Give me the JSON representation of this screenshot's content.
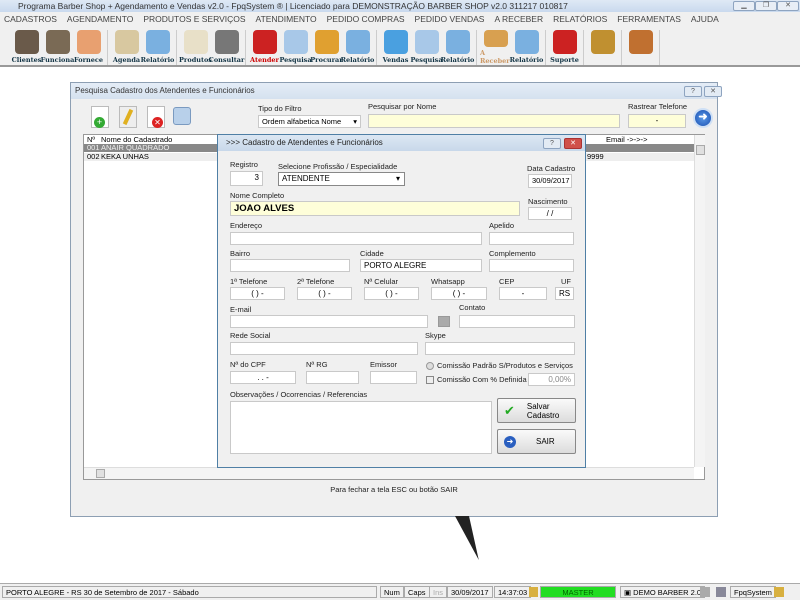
{
  "window": {
    "title": "Programa Barber Shop + Agendamento e Vendas v2.0 - FpqSystem ® | Licenciado para  DEMONSTRAÇÃO BARBER SHOP v2.0 311217 010817"
  },
  "menu": [
    "CADASTROS",
    "AGENDAMENTO",
    "PRODUTOS E SERVIÇOS",
    "ATENDIMENTO",
    "PEDIDO COMPRAS",
    "PEDIDO VENDAS",
    "A RECEBER",
    "RELATÓRIOS",
    "FERRAMENTAS",
    "AJUDA"
  ],
  "toolbar": [
    [
      {
        "label": "Clientes",
        "color": "#6a5a4a"
      },
      {
        "label": "Funciona",
        "color": "#7a6a55"
      },
      {
        "label": "Fornece",
        "color": "#e8a070"
      }
    ],
    [
      {
        "label": "Agenda",
        "color": "#d8c8a0"
      },
      {
        "label": "Relatório",
        "color": "#7ab0e0"
      }
    ],
    [
      {
        "label": "Produtos",
        "color": "#e8e0c8"
      },
      {
        "label": "Consultar",
        "color": "#777777"
      }
    ],
    [
      {
        "label": "Atender",
        "color": "#cc2222"
      },
      {
        "label": "Pesquisa",
        "color": "#a8c8e8"
      },
      {
        "label": "Procurar",
        "color": "#e0a030"
      },
      {
        "label": "Relatório",
        "color": "#7ab0e0"
      }
    ],
    [
      {
        "label": "Vendas",
        "color": "#4aa0e0"
      },
      {
        "label": "Pesquisa",
        "color": "#a8c8e8"
      },
      {
        "label": "Relatório",
        "color": "#7ab0e0"
      }
    ],
    [
      {
        "label": "A Receber",
        "color": "#d8a050"
      },
      {
        "label": "Relatório",
        "color": "#7ab0e0"
      }
    ],
    [
      {
        "label": "Suporte",
        "color": "#cc2222"
      }
    ],
    [
      {
        "label": "",
        "color": "#c09030"
      }
    ],
    [
      {
        "label": "",
        "color": "#c07030"
      }
    ]
  ],
  "search": {
    "title": "Pesquisa Cadastro dos Atendentes e Funcionários",
    "filter_label": "Tipo do Filtro",
    "filter_value": "Ordem alfabetica Nome",
    "name_label": "Pesquisar por Nome",
    "name_value": "",
    "phone_label": "Rastrear Telefone",
    "phone_value": "-",
    "columns": {
      "num": "Nº",
      "name": "Nome do Cadastrado",
      "email": "Email ->->->"
    },
    "rows": [
      {
        "num": "001",
        "name": "ANAIR QUADRADO",
        "phone": ""
      },
      {
        "num": "002",
        "name": "KEKA UNHAS",
        "phone": "9999"
      }
    ],
    "footer": "Para fechar a tela ESC ou botão SAIR"
  },
  "dialog": {
    "title": ">>> Cadastro de Atendentes e Funcionários",
    "registro_label": "Registro",
    "registro": "3",
    "profissao_label": "Selecione Profissão / Especialidade",
    "profissao": "ATENDENTE",
    "data_label": "Data Cadastro",
    "data": "30/09/2017",
    "nome_label": "Nome Completo",
    "nome": "JOAO ALVES",
    "nasc_label": "Nascimento",
    "nasc": " / /",
    "endereco_label": "Endereço",
    "apelido_label": "Apelido",
    "bairro_label": "Bairro",
    "cidade_label": "Cidade",
    "cidade": "PORTO ALEGRE",
    "complemento_label": "Complemento",
    "tel1_label": "1ª Telefone",
    "tel1": "(  )   -",
    "tel2_label": "2ª Telefone",
    "tel2": "(  )   -",
    "cel_label": "Nª Celular",
    "cel": "(  )   -",
    "whats_label": "Whatsapp",
    "whats": "(  )   -",
    "cep_label": "CEP",
    "cep": "-",
    "uf_label": "UF",
    "uf": "RS",
    "email_label": "E-mail",
    "contato_label": "Contato",
    "rede_label": "Rede Social",
    "skype_label": "Skype",
    "cpf_label": "Nª do CPF",
    "cpf": ".   .   -",
    "rg_label": "Nª RG",
    "emissor_label": "Emissor",
    "comissao_padrao": "Comissão Padrão S/Produtos e Serviços",
    "comissao_def": "Comissão Com % Definida ->",
    "comissao_val": "0,00%",
    "obs_label": "Observações / Ocorrencias / Referencias",
    "salvar": "Salvar Cadastro",
    "sair": "SAIR"
  },
  "status": {
    "location": "PORTO ALEGRE - RS 30 de Setembro de 2017 - Sábado",
    "num": "Num",
    "caps": "Caps",
    "ins": "Ins",
    "date": "30/09/2017",
    "time": "14:37:03",
    "user": "MASTER",
    "company": "DEMO BARBER 2.0",
    "brand": "FpqSystem"
  }
}
